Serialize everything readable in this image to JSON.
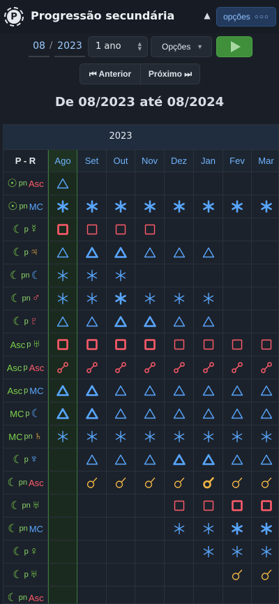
{
  "header": {
    "title": "Progressão secundária",
    "logo_letter": "P",
    "options_label": "opções"
  },
  "controls": {
    "month": "08",
    "year": "2023",
    "span": "1 ano",
    "options_select": "Opções",
    "prev_label": "Anterior",
    "next_label": "Próximo"
  },
  "range_title": "De 08/2023 até 08/2024",
  "table": {
    "year": "2023",
    "corner": "P - R",
    "months": [
      "Ago",
      "Set",
      "Out",
      "Nov",
      "Dez",
      "Jan",
      "Fev",
      "Mar"
    ],
    "current_month_index": 0,
    "colors": {
      "green": "#7bd14a",
      "red": "#ff5b6a",
      "blue": "#58a6ff",
      "gold": "#f0b546"
    },
    "rows": [
      {
        "p": "☉",
        "pc": "green",
        "mid": "pn",
        "r": "Asc",
        "rc": "red",
        "cells": [
          "tri1",
          "",
          "",
          "",
          "",
          "",
          "",
          ""
        ]
      },
      {
        "p": "☉",
        "pc": "green",
        "mid": "pn",
        "r": "MC",
        "rc": "blue",
        "cells": [
          "sex3",
          "sex3",
          "sex3",
          "sex3",
          "sex3",
          "sex3",
          "sex3",
          "sex3"
        ]
      },
      {
        "p": "☾",
        "pc": "green",
        "mid": "p",
        "r": "☿",
        "rc": "green",
        "cells": [
          "sq3",
          "sq1",
          "sq1",
          "sq1",
          "",
          "",
          "",
          ""
        ]
      },
      {
        "p": "☾",
        "pc": "green",
        "mid": "p",
        "r": "♃",
        "rc": "gold",
        "cells": [
          "tri1",
          "tri3",
          "tri3",
          "tri1",
          "tri1",
          "tri1",
          "",
          ""
        ]
      },
      {
        "p": "☾",
        "pc": "green",
        "mid": "pn",
        "r": "☾",
        "rc": "blue",
        "cells": [
          "sex1",
          "sex1",
          "sex1",
          "",
          "",
          "",
          "",
          ""
        ]
      },
      {
        "p": "☾",
        "pc": "green",
        "mid": "pn",
        "r": "♂",
        "rc": "red",
        "cells": [
          "sex1",
          "sex1",
          "sex3",
          "sex1",
          "sex1",
          "sex1",
          "",
          ""
        ]
      },
      {
        "p": "☾",
        "pc": "green",
        "mid": "p",
        "r": "♇",
        "rc": "red",
        "cells": [
          "tri1",
          "tri1",
          "tri3",
          "tri3",
          "tri1",
          "tri1",
          "",
          ""
        ]
      },
      {
        "p": "Asc",
        "pc": "green",
        "mid": "p",
        "r": "♅",
        "rc": "green",
        "cells": [
          "sq3",
          "sq3",
          "sq3",
          "sq3",
          "sq1",
          "sq1",
          "sq1",
          "sq1"
        ]
      },
      {
        "p": "Asc",
        "pc": "green",
        "mid": "p",
        "r": "Asc",
        "rc": "red",
        "cells": [
          "opp",
          "opp",
          "opp",
          "opp",
          "opp",
          "opp",
          "opp",
          "opp"
        ]
      },
      {
        "p": "Asc",
        "pc": "green",
        "mid": "p",
        "r": "MC",
        "rc": "blue",
        "cells": [
          "tri3",
          "tri3",
          "tri1",
          "tri1",
          "tri1",
          "tri1",
          "tri1",
          "tri1"
        ]
      },
      {
        "p": "MC",
        "pc": "green",
        "mid": "p",
        "r": "☾",
        "rc": "blue",
        "cells": [
          "tri3",
          "tri3",
          "tri1",
          "tri1",
          "tri1",
          "tri1",
          "tri1",
          "tri1"
        ]
      },
      {
        "p": "MC",
        "pc": "green",
        "mid": "pn",
        "r": "♄",
        "rc": "gold",
        "cells": [
          "sex1",
          "sex1",
          "sex1",
          "sex1",
          "sex1",
          "sex1",
          "sex1",
          "sex1"
        ]
      },
      {
        "p": "☾",
        "pc": "green",
        "mid": "p",
        "r": "♆",
        "rc": "blue",
        "cells": [
          "",
          "tri1",
          "tri1",
          "tri1",
          "tri3",
          "tri3",
          "tri1",
          "tri1"
        ]
      },
      {
        "p": "☾",
        "pc": "green",
        "mid": "pn",
        "r": "Asc",
        "rc": "red",
        "cells": [
          "",
          "con1",
          "con1",
          "con1",
          "con1",
          "con3",
          "con1",
          "con1"
        ]
      },
      {
        "p": "☾",
        "pc": "green",
        "mid": "pn",
        "r": "♅",
        "rc": "green",
        "cells": [
          "",
          "",
          "",
          "",
          "sq1",
          "sq1",
          "sq3",
          "sq3"
        ]
      },
      {
        "p": "☾",
        "pc": "green",
        "mid": "pn",
        "r": "MC",
        "rc": "blue",
        "cells": [
          "",
          "",
          "",
          "",
          "sex1",
          "sex1",
          "sex3",
          "sex3"
        ]
      },
      {
        "p": "☾",
        "pc": "green",
        "mid": "p",
        "r": "♀",
        "rc": "green",
        "cells": [
          "",
          "",
          "",
          "",
          "",
          "sex1",
          "sex1",
          "sex1"
        ]
      },
      {
        "p": "☾",
        "pc": "green",
        "mid": "p",
        "r": "♅",
        "rc": "green",
        "cells": [
          "",
          "",
          "",
          "",
          "",
          "",
          "con1",
          "con1"
        ]
      },
      {
        "p": "☾",
        "pc": "green",
        "mid": "pn",
        "r": "Asc",
        "rc": "red",
        "cells": [
          "",
          "",
          "",
          "",
          "",
          "",
          "",
          ""
        ]
      }
    ]
  }
}
